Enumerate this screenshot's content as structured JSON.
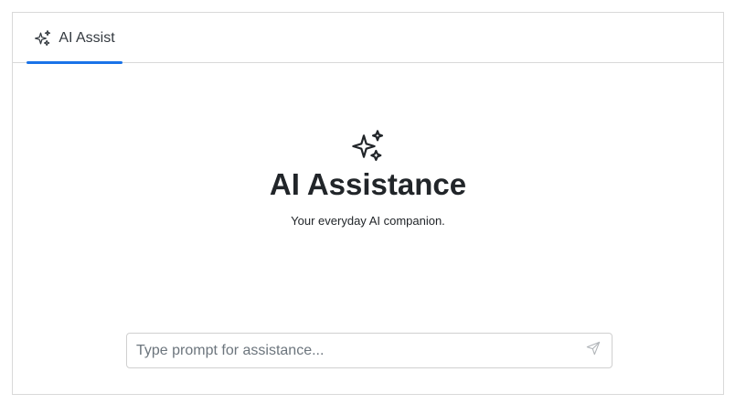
{
  "tabs": [
    {
      "label": "AI Assist",
      "icon": "sparkles-icon",
      "active": true
    }
  ],
  "hero": {
    "icon": "sparkles-icon",
    "title": "AI Assistance",
    "subtitle": "Your everyday AI companion."
  },
  "prompt": {
    "value": "",
    "placeholder": "Type prompt for assistance...",
    "send_icon": "send-icon"
  },
  "colors": {
    "accent": "#1a73e8",
    "border": "#d9d9d9",
    "text": "#212529",
    "placeholder": "#6c757d",
    "send_icon": "#b0b4b8"
  }
}
